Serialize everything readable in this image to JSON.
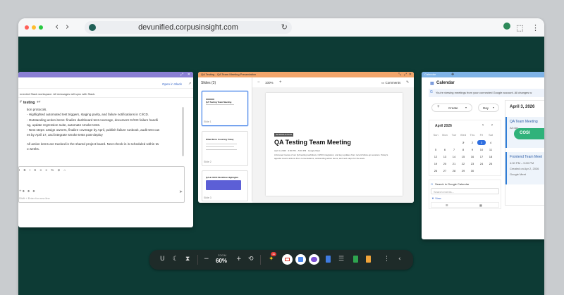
{
  "browser": {
    "url": "devunified.corpusinsight.com"
  },
  "slack": {
    "open_in_slack": "Open in Slack",
    "connected_notice": "nnected Slack workspace. All messages will sync with Slack.",
    "channel": "testing",
    "lines": [
      "tion protocols.",
      "- Highlighted automated test triggers, staging parity, and failure notifications in CI/CD.",
      "- Outstanding action items: finalize dashboard test coverage, document CI/CD failure handli",
      "ng, update regression suite, automate smoke tests.",
      "- Next steps: assign owners, finalize coverage by April, publish failure runbook, audit test cas",
      "es by April 17, and integrate smoke tests post-deploy",
      "All action items are tracked in the shared project board. Next check-in is scheduled within tw",
      "o weeks."
    ],
    "footer": "Shift + Enter for new line"
  },
  "slides": {
    "title": "QA Testing - QA Team Meeting Presentation",
    "slides_label": "Slides (3)",
    "zoom": "100%",
    "comments": "Comments",
    "thumbs": [
      {
        "title": "QA Testing Team Meeting",
        "label": "Slide 1"
      },
      {
        "title": "What We're Covering Today",
        "label": "Slide 2"
      },
      {
        "title": "QA & CI/CD Workflow Highlights",
        "label": "Slide 3"
      }
    ],
    "main": {
      "tag": "INTRODUCTION",
      "heading": "QA Testing Team Meeting",
      "meta": "April 3, 2026  ·  3:00 PM – 5:00 PM  ·  Google Meet",
      "body": "A focused review of our QA testing workflows, CI/CD integration, and key updates from recent follow-up sessions. Today's agenda covers actions from conversations, outstanding action items, and next steps for the team."
    }
  },
  "calendar": {
    "title": "Calendar",
    "heading": "Calendar",
    "notice": "You're viewing meetings from your connected Google account. All changes w",
    "create": "Create",
    "view": "Day",
    "date_label": "April 3, 2026",
    "month": "April 2026",
    "weekdays": [
      "Sun",
      "Mon",
      "Tue",
      "Wed",
      "Thu",
      "Fri",
      "Sat"
    ],
    "weeks": [
      [
        "",
        "",
        "",
        "1",
        "2",
        "3",
        "4"
      ],
      [
        "5",
        "6",
        "7",
        "8",
        "9",
        "10",
        "11"
      ],
      [
        "12",
        "13",
        "14",
        "15",
        "16",
        "17",
        "18"
      ],
      [
        "19",
        "20",
        "21",
        "22",
        "23",
        "24",
        "25"
      ],
      [
        "26",
        "27",
        "28",
        "29",
        "30",
        "",
        ""
      ]
    ],
    "search_title": "Search in Google Calendar",
    "search_placeholder": "Search events...",
    "filter": "View",
    "events": [
      {
        "title": "QA Team Meeting",
        "time": "All day"
      },
      {
        "title": "Frontend Team Meet",
        "time": "4:00 PM – 5:00 PM",
        "created": "Created on Apr 2, 2026",
        "source": "Google Meet"
      }
    ],
    "badge": "COSI"
  },
  "dock": {
    "zoom_label": "ZOOM",
    "zoom": "60%",
    "notif_count": "11"
  }
}
